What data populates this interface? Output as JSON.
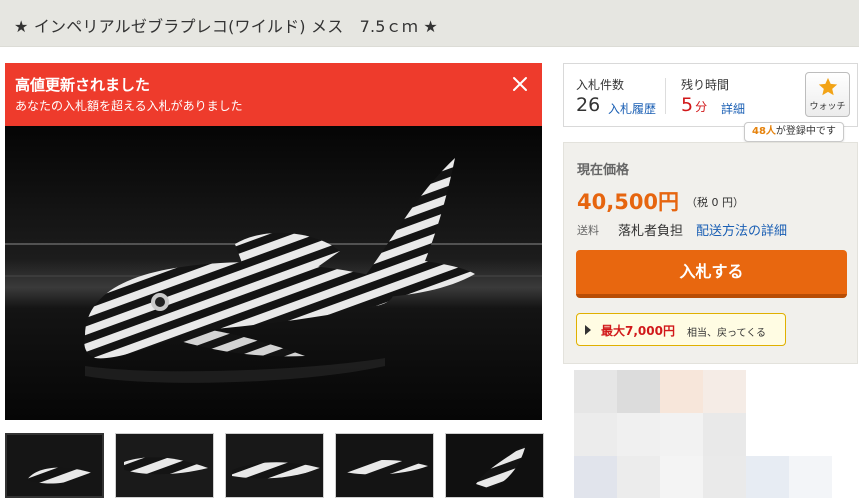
{
  "listing": {
    "title": "★ インペリアルゼブラプレコ(ワイルド) メス　7.5ｃｍ ★"
  },
  "alert": {
    "heading": "高値更新されました",
    "message": "あなたの入札額を超える入札がありました",
    "close_icon": "close-icon"
  },
  "bids": {
    "label": "入札件数",
    "count": "26",
    "history_link": "入札履歴"
  },
  "time_left": {
    "label": "残り時間",
    "value": "5",
    "unit": "分",
    "detail_link": "詳細"
  },
  "watch": {
    "label": "ウォッチ",
    "icon": "star-icon",
    "tooltip_count": "48人",
    "tooltip_text": "が登録中です"
  },
  "price": {
    "label": "現在価格",
    "value": "40,500円",
    "tax": "（税 0 円）",
    "shipping_label": "送料",
    "shipping_value": "落札者負担",
    "shipping_link": "配送方法の詳細"
  },
  "bid_button": {
    "label": "入札する"
  },
  "max_note": {
    "amount": "最大7,000円",
    "rest": "相当、戻ってくる"
  },
  "colors": {
    "accent_orange": "#e8670f",
    "alert_red": "#ee3b2c",
    "link_blue": "#1a5fb4",
    "price_orange": "#e6650f"
  },
  "gallery": {
    "thumbnail_count": 5,
    "active_index": 0
  }
}
